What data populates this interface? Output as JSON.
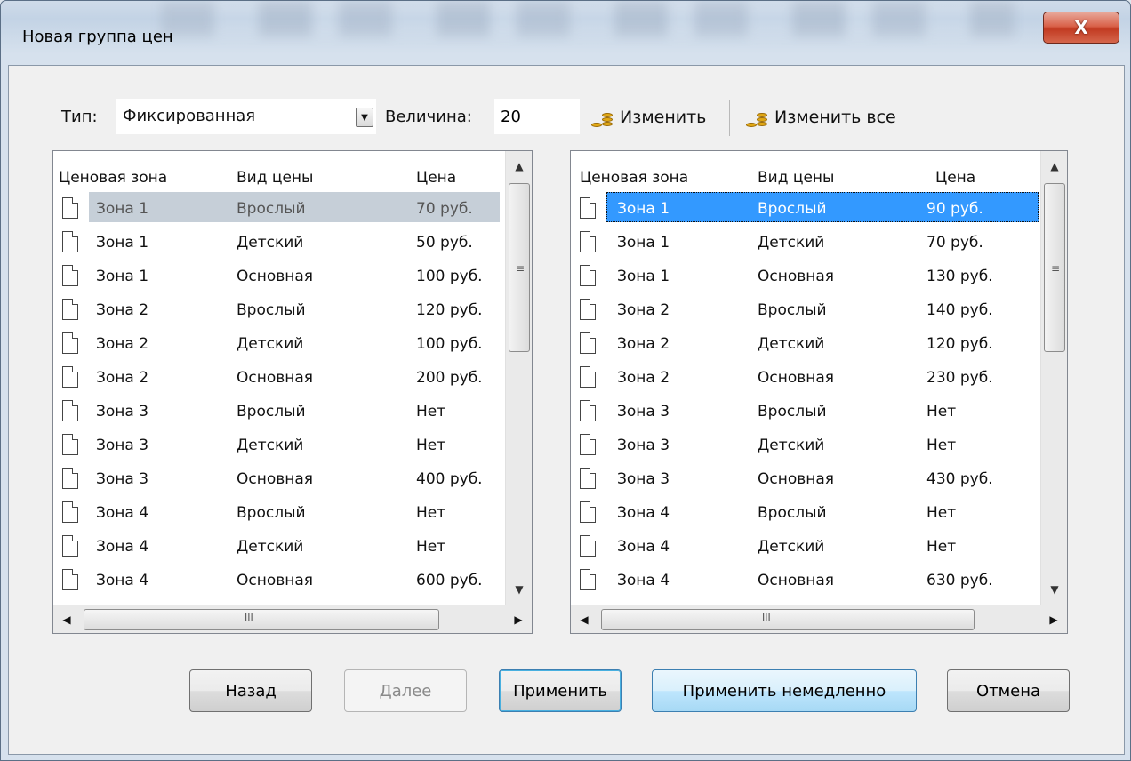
{
  "window": {
    "title": "Новая группа цен",
    "close_label": "X"
  },
  "toolbar": {
    "type_label": "Тип:",
    "type_value": "Фиксированная",
    "amount_label": "Величина:",
    "amount_value": "20",
    "change_label": "Изменить",
    "change_all_label": "Изменить все",
    "icons": [
      "coins-icon",
      "dropdown-arrow-icon"
    ]
  },
  "columns": [
    "Ценовая зона",
    "Вид цены",
    "Цена"
  ],
  "left_list": {
    "rows": [
      [
        "Зона 1",
        "Врослый",
        "70 руб."
      ],
      [
        "Зона 1",
        "Детский",
        "50 руб."
      ],
      [
        "Зона 1",
        "Основная",
        "100 руб."
      ],
      [
        "Зона 2",
        "Врослый",
        "120 руб."
      ],
      [
        "Зона 2",
        "Детский",
        "100 руб."
      ],
      [
        "Зона 2",
        "Основная",
        "200 руб."
      ],
      [
        "Зона 3",
        "Врослый",
        "Нет"
      ],
      [
        "Зона 3",
        "Детский",
        "Нет"
      ],
      [
        "Зона 3",
        "Основная",
        "400 руб."
      ],
      [
        "Зона 4",
        "Врослый",
        "Нет"
      ],
      [
        "Зона 4",
        "Детский",
        "Нет"
      ],
      [
        "Зона 4",
        "Основная",
        "600 руб."
      ]
    ],
    "selected_index": 0
  },
  "right_list": {
    "rows": [
      [
        "Зона 1",
        "Врослый",
        "90 руб."
      ],
      [
        "Зона 1",
        "Детский",
        "70 руб."
      ],
      [
        "Зона 1",
        "Основная",
        "130 руб."
      ],
      [
        "Зона 2",
        "Врослый",
        "140 руб."
      ],
      [
        "Зона 2",
        "Детский",
        "120 руб."
      ],
      [
        "Зона 2",
        "Основная",
        "230 руб."
      ],
      [
        "Зона 3",
        "Врослый",
        "Нет"
      ],
      [
        "Зона 3",
        "Детский",
        "Нет"
      ],
      [
        "Зона 3",
        "Основная",
        "430 руб."
      ],
      [
        "Зона 4",
        "Врослый",
        "Нет"
      ],
      [
        "Зона 4",
        "Детский",
        "Нет"
      ],
      [
        "Зона 4",
        "Основная",
        "630 руб."
      ]
    ],
    "selected_index": 0
  },
  "buttons": {
    "back": "Назад",
    "next": "Далее",
    "apply": "Применить",
    "apply_now": "Применить немедленно",
    "cancel": "Отмена"
  },
  "colors": {
    "selection_active": "#3399ff",
    "selection_inactive": "#c6cfd8",
    "close_button": "#c23b22"
  }
}
